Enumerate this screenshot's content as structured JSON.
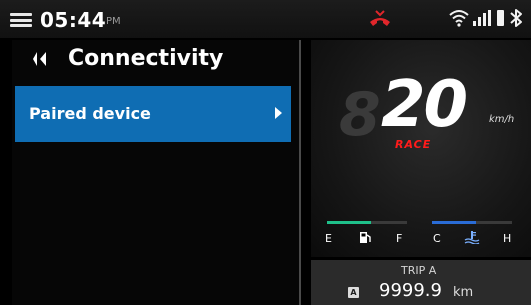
{
  "status_bar": {
    "time": "05:44",
    "ampm": "PM",
    "icons": [
      "menu-icon",
      "missed-call-icon",
      "wifi-icon",
      "signal-icon",
      "battery-icon",
      "bluetooth-icon"
    ],
    "call_icon_color": "#e0262b"
  },
  "screen": {
    "title": "Connectivity",
    "back_icon": "back-arrow-icon",
    "menu_items": [
      {
        "label": "Paired device",
        "selected": true,
        "icon": "chevron-right-icon"
      }
    ],
    "accent_color": "#0f6db3"
  },
  "cluster": {
    "speed": "20",
    "ghost_digit": "8",
    "speed_unit": "km/h",
    "ride_mode": "RACE",
    "mode_color": "#ff1b1b",
    "fuel": {
      "empty_label": "E",
      "full_label": "F",
      "icon": "fuel-pump-icon",
      "color": "#1fc08a",
      "level": 0.55
    },
    "temp": {
      "cold_label": "C",
      "hot_label": "H",
      "icon": "coolant-temp-icon",
      "color": "#2a6cd6",
      "level": 0.55
    }
  },
  "trip": {
    "label": "TRIP A",
    "badge": "A",
    "value": "9999.9",
    "unit": "km"
  }
}
